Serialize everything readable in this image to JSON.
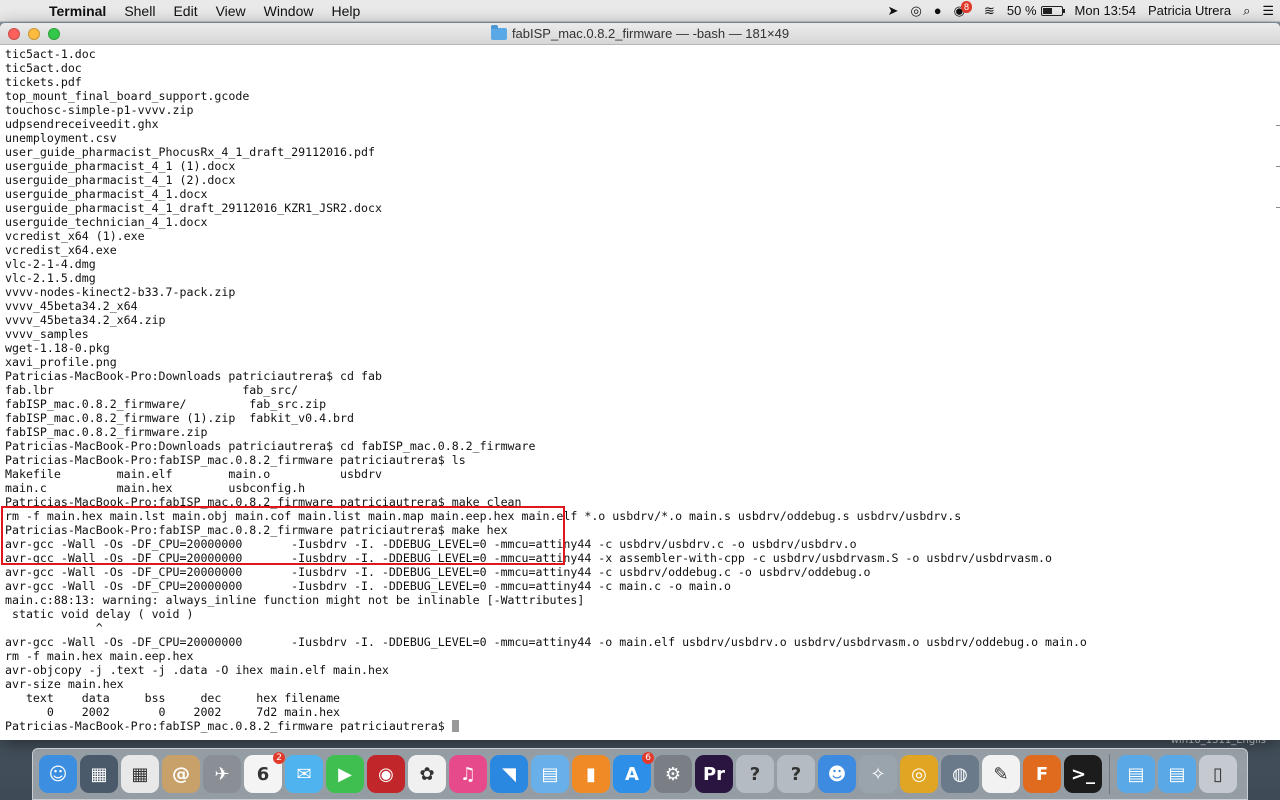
{
  "menubar": {
    "app_name": "Terminal",
    "menus": [
      "Shell",
      "Edit",
      "View",
      "Window",
      "Help"
    ],
    "status": {
      "notification_badge": "8",
      "battery_percent": "50 %",
      "battery_level": 0.5,
      "clock": "Mon 13:54",
      "user": "Patricia Utrera"
    }
  },
  "window": {
    "title": "fabISP_mac.0.8.2_firmware — -bash — 181×49"
  },
  "terminal": {
    "lines": [
      "tic5act-1.doc",
      "tic5act.doc",
      "tickets.pdf",
      "top_mount_final_board_support.gcode",
      "touchosc-simple-p1-vvvv.zip",
      "udpsendreceiveedit.ghx",
      "unemployment.csv",
      "user_guide_pharmacist_PhocusRx_4_1_draft_29112016.pdf",
      "userguide_pharmacist_4_1 (1).docx",
      "userguide_pharmacist_4_1 (2).docx",
      "userguide_pharmacist_4_1.docx",
      "userguide_pharmacist_4_1_draft_29112016_KZR1_JSR2.docx",
      "userguide_technician_4_1.docx",
      "vcredist_x64 (1).exe",
      "vcredist_x64.exe",
      "vlc-2-1-4.dmg",
      "vlc-2.1.5.dmg",
      "vvvv-nodes-kinect2-b33.7-pack.zip",
      "vvvv_45beta34.2_x64",
      "vvvv_45beta34.2_x64.zip",
      "vvvv_samples",
      "wget-1.18-0.pkg",
      "xavi_profile.png",
      "Patricias-MacBook-Pro:Downloads patriciautrera$ cd fab",
      "fab.lbr                           fab_src/",
      "fabISP_mac.0.8.2_firmware/         fab_src.zip",
      "fabISP_mac.0.8.2_firmware (1).zip  fabkit_v0.4.brd",
      "fabISP_mac.0.8.2_firmware.zip",
      "Patricias-MacBook-Pro:Downloads patriciautrera$ cd fabISP_mac.0.8.2_firmware",
      "Patricias-MacBook-Pro:fabISP_mac.0.8.2_firmware patriciautrera$ ls",
      "Makefile        main.elf        main.o          usbdrv",
      "main.c          main.hex        usbconfig.h",
      "Patricias-MacBook-Pro:fabISP_mac.0.8.2_firmware patriciautrera$ make clean",
      "rm -f main.hex main.lst main.obj main.cof main.list main.map main.eep.hex main.elf *.o usbdrv/*.o main.s usbdrv/oddebug.s usbdrv/usbdrv.s",
      "Patricias-MacBook-Pro:fabISP_mac.0.8.2_firmware patriciautrera$ make hex",
      "avr-gcc -Wall -Os -DF_CPU=20000000       -Iusbdrv -I. -DDEBUG_LEVEL=0 -mmcu=attiny44 -c usbdrv/usbdrv.c -o usbdrv/usbdrv.o",
      "avr-gcc -Wall -Os -DF_CPU=20000000       -Iusbdrv -I. -DDEBUG_LEVEL=0 -mmcu=attiny44 -x assembler-with-cpp -c usbdrv/usbdrvasm.S -o usbdrv/usbdrvasm.o",
      "avr-gcc -Wall -Os -DF_CPU=20000000       -Iusbdrv -I. -DDEBUG_LEVEL=0 -mmcu=attiny44 -c usbdrv/oddebug.c -o usbdrv/oddebug.o",
      "avr-gcc -Wall -Os -DF_CPU=20000000       -Iusbdrv -I. -DDEBUG_LEVEL=0 -mmcu=attiny44 -c main.c -o main.o",
      "main.c:88:13: warning: always_inline function might not be inlinable [-Wattributes]",
      " static void delay ( void )",
      "             ^",
      "avr-gcc -Wall -Os -DF_CPU=20000000       -Iusbdrv -I. -DDEBUG_LEVEL=0 -mmcu=attiny44 -o main.elf usbdrv/usbdrv.o usbdrv/usbdrvasm.o usbdrv/oddebug.o main.o",
      "rm -f main.hex main.eep.hex",
      "avr-objcopy -j .text -j .data -O ihex main.elf main.hex",
      "avr-size main.hex",
      "   text    data     bss     dec     hex filename",
      "      0    2002       0    2002     7d2 main.hex"
    ],
    "prompt": "Patricias-MacBook-Pro:fabISP_mac.0.8.2_firmware patriciautrera$ "
  },
  "desktop": {
    "label": "win10_1511_Englis"
  },
  "dock": {
    "items": [
      {
        "name": "finder-icon",
        "glyph": "☺",
        "color": "#3c8fe0"
      },
      {
        "name": "photo-browser-icon",
        "glyph": "▦",
        "color": "#4a5a6a"
      },
      {
        "name": "launchpad-icon",
        "glyph": "▦",
        "color": "#e8e8e8"
      },
      {
        "name": "contacts-icon",
        "glyph": "@",
        "color": "#c8a06a"
      },
      {
        "name": "rocket-icon",
        "glyph": "✈",
        "color": "#8a8f96"
      },
      {
        "name": "calendar-icon",
        "glyph": "6",
        "color": "#f4f4f4",
        "badge": "2"
      },
      {
        "name": "messages-icon",
        "glyph": "✉",
        "color": "#4fb3f0"
      },
      {
        "name": "facetime-icon",
        "glyph": "▶",
        "color": "#3fbf4f"
      },
      {
        "name": "photo-booth-icon",
        "glyph": "◉",
        "color": "#c0262a"
      },
      {
        "name": "photos-icon",
        "glyph": "✿",
        "color": "#f0f0f0"
      },
      {
        "name": "itunes-icon",
        "glyph": "♫",
        "color": "#e64a8a"
      },
      {
        "name": "bird-app-icon",
        "glyph": "◥",
        "color": "#2a88e0"
      },
      {
        "name": "preview-icon",
        "glyph": "▤",
        "color": "#6ab0e8"
      },
      {
        "name": "ibooks-icon",
        "glyph": "▮",
        "color": "#f08a24"
      },
      {
        "name": "app-store-icon",
        "glyph": "A",
        "color": "#2d8fe8",
        "badge": "6"
      },
      {
        "name": "system-preferences-icon",
        "glyph": "⚙",
        "color": "#7a7f86"
      },
      {
        "name": "premiere-icon",
        "glyph": "Pr",
        "color": "#2a1540"
      },
      {
        "name": "help-icon",
        "glyph": "?",
        "color": "#b5bbc2"
      },
      {
        "name": "help-icon-2",
        "glyph": "?",
        "color": "#b5bbc2"
      },
      {
        "name": "people-icon",
        "glyph": "☻",
        "color": "#3d8be0"
      },
      {
        "name": "satellite-icon",
        "glyph": "✧",
        "color": "#9aa4ad"
      },
      {
        "name": "chrome-icon",
        "glyph": "◎",
        "color": "#e0a623"
      },
      {
        "name": "network-icon",
        "glyph": "◍",
        "color": "#6a7a8a"
      },
      {
        "name": "textedit-icon",
        "glyph": "✎",
        "color": "#f2f2f2"
      },
      {
        "name": "fusion-360-icon",
        "glyph": "F",
        "color": "#e06a1e"
      },
      {
        "name": "terminal-icon",
        "glyph": ">_",
        "color": "#1c1c1c"
      }
    ],
    "stack_items": [
      {
        "name": "folder-stack-icon",
        "glyph": "▤",
        "color": "#5aa9e6"
      },
      {
        "name": "downloads-folder-icon",
        "glyph": "▤",
        "color": "#5aa9e6"
      },
      {
        "name": "trash-icon",
        "glyph": "▯",
        "color": "#c4cad0"
      }
    ]
  }
}
